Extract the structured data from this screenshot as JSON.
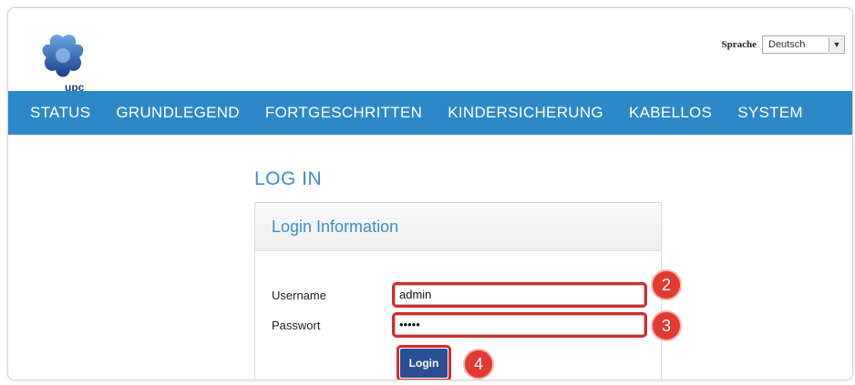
{
  "brand": {
    "logo_text": "upc"
  },
  "language": {
    "label": "Sprache",
    "selected": "Deutsch"
  },
  "nav": {
    "items": [
      {
        "label": "STATUS"
      },
      {
        "label": "GRUNDLEGEND"
      },
      {
        "label": "FORTGESCHRITTEN"
      },
      {
        "label": "KINDERSICHERUNG"
      },
      {
        "label": "KABELLOS"
      },
      {
        "label": "SYSTEM"
      }
    ]
  },
  "main": {
    "title": "LOG IN",
    "panel_title": "Login Information",
    "username_label": "Username",
    "username_value": "admin",
    "password_label": "Passwort",
    "password_value": "•••••",
    "login_label": "Login"
  },
  "annotations": {
    "step_username": "2",
    "step_password": "3",
    "step_login": "4"
  },
  "colors": {
    "nav_bg": "#2d88c9",
    "accent": "#3a8fcf",
    "button": "#2b4f93",
    "highlight": "#d62a2a"
  }
}
